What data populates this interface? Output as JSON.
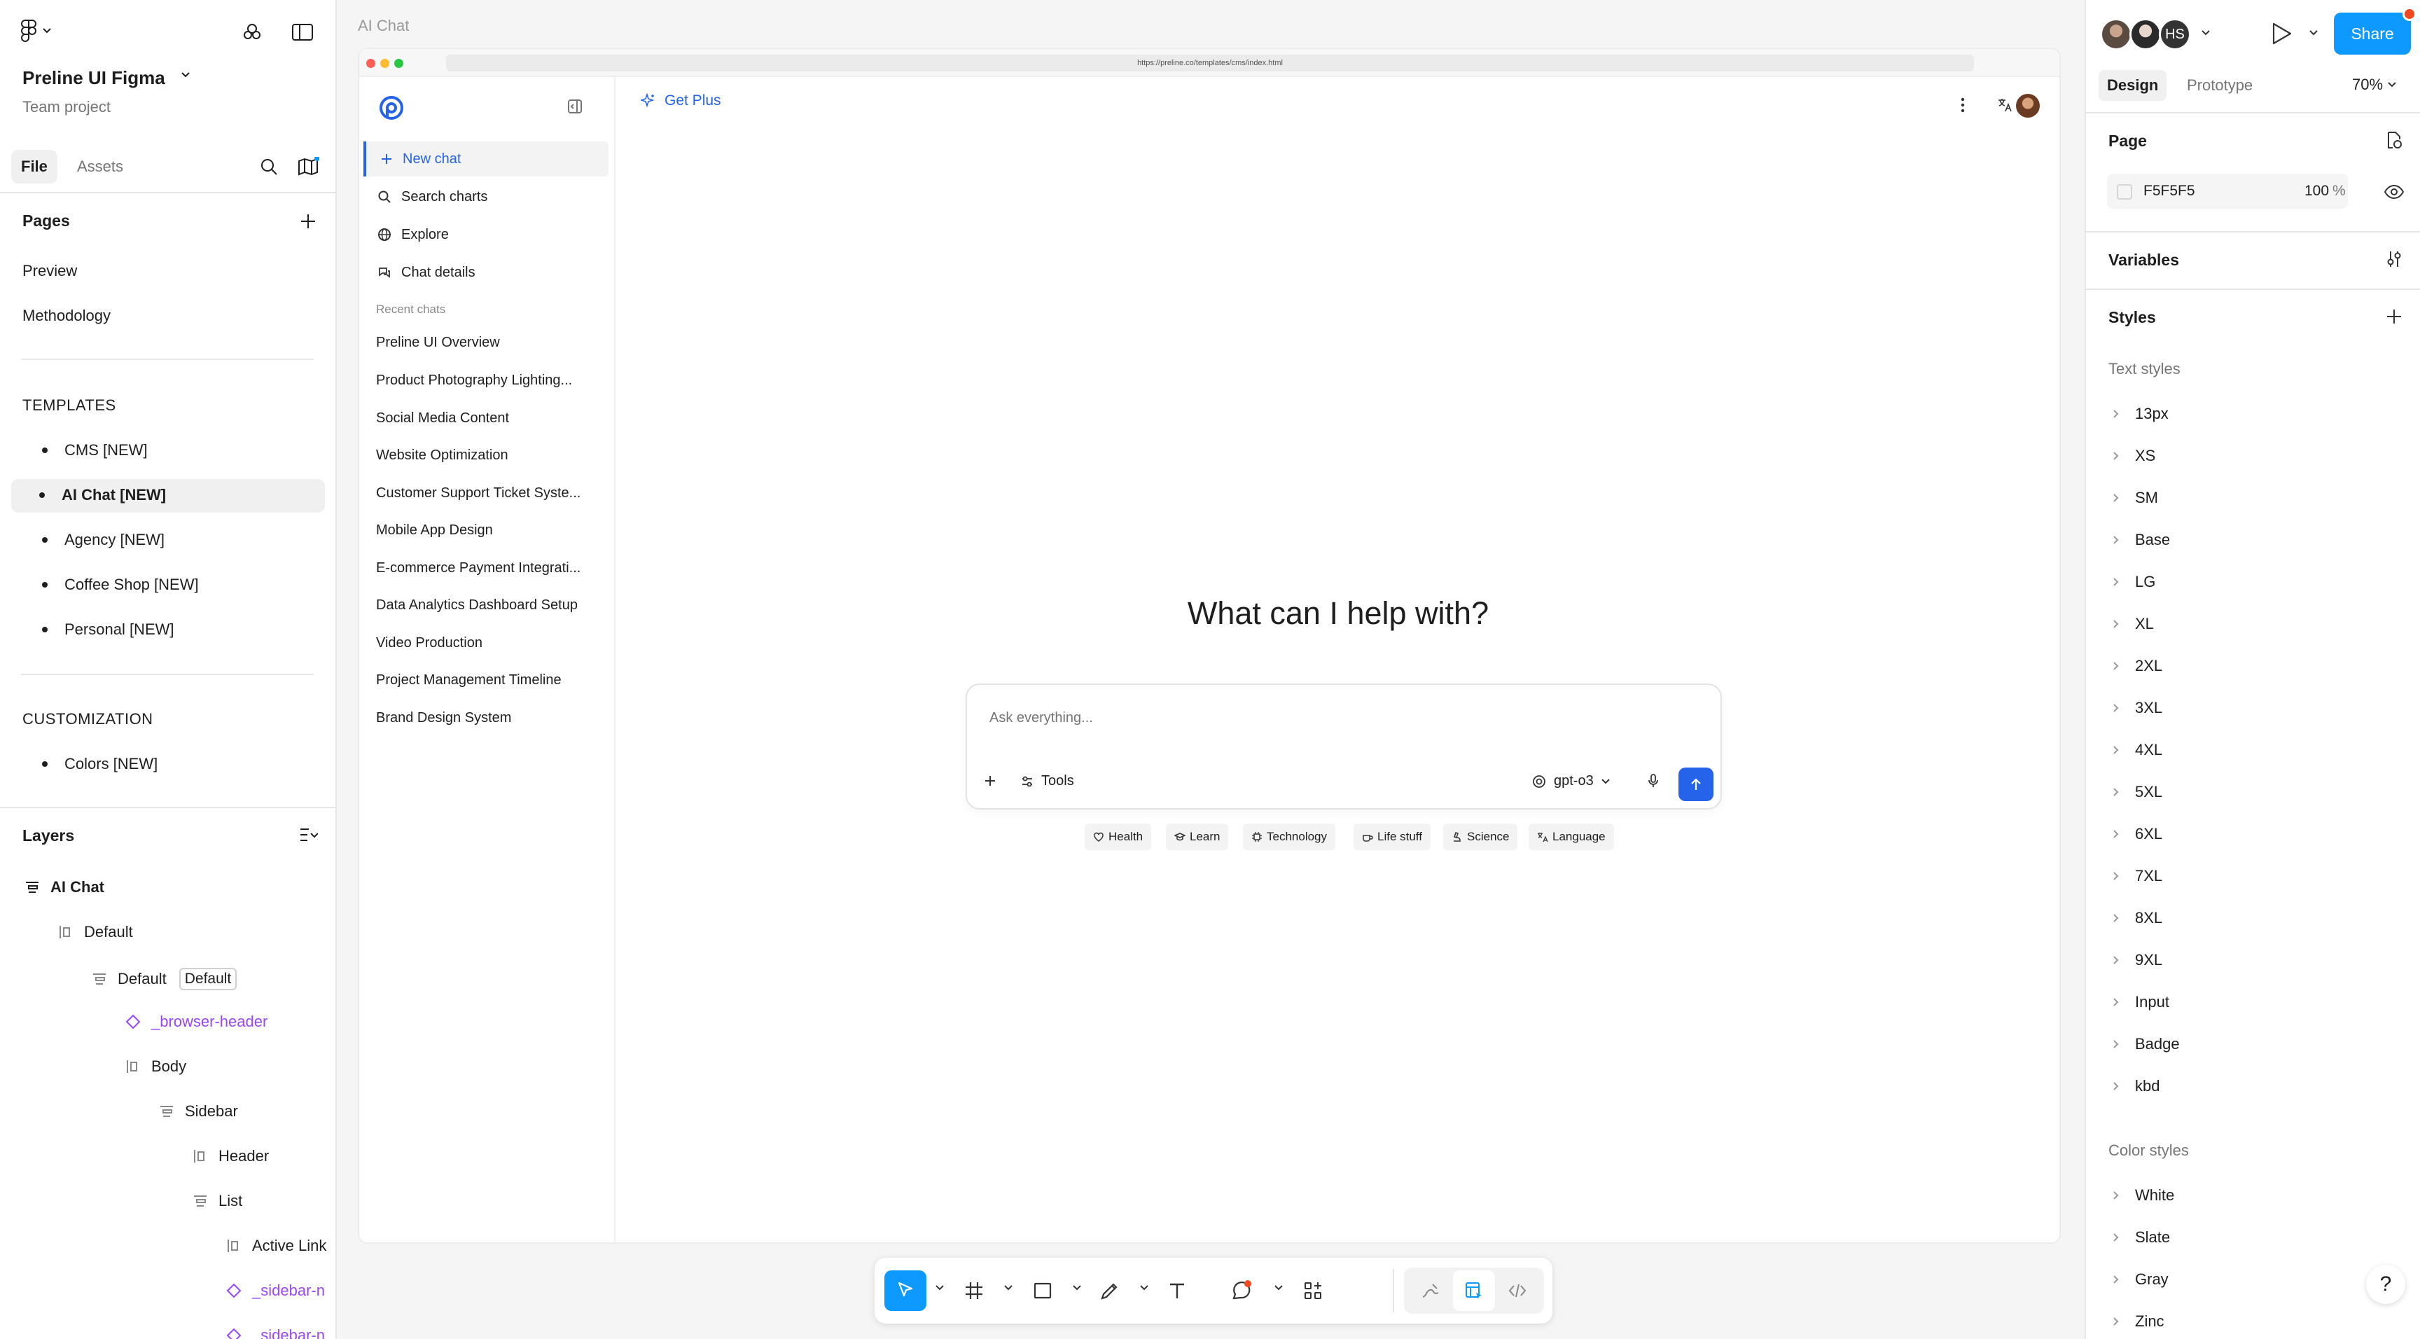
{
  "left_panel": {
    "project_name": "Preline UI Figma",
    "project_sub": "Team project",
    "tabs": {
      "file": "File",
      "assets": "Assets"
    },
    "pages_title": "Pages",
    "pages": [
      "Preview",
      "Methodology"
    ],
    "templates_heading": "TEMPLATES",
    "templates": [
      "CMS [NEW]",
      "AI Chat [NEW]",
      "Agency [NEW]",
      "Coffee Shop [NEW]",
      "Personal [NEW]"
    ],
    "customization_heading": "CUSTOMIZATION",
    "customization": [
      "Colors [NEW]"
    ],
    "layers_title": "Layers",
    "layers": {
      "root": "AI Chat",
      "default1": "Default",
      "default2": "Default",
      "default2_badge": "Default",
      "browser_header": "_browser-header",
      "body": "Body",
      "sidebar": "Sidebar",
      "header": "Header",
      "list": "List",
      "active_link": "Active Link",
      "sidebar_n1": "_sidebar-n",
      "sidebar_n2": "_sidebar-n"
    }
  },
  "canvas": {
    "frame_label": "AI Chat",
    "url": "https://preline.co/templates/cms/index.html",
    "sidebar": {
      "nav": [
        {
          "label": "New chat",
          "icon": "plus-icon"
        },
        {
          "label": "Search charts",
          "icon": "search-icon"
        },
        {
          "label": "Explore",
          "icon": "globe-icon"
        },
        {
          "label": "Chat details",
          "icon": "chat-icon"
        }
      ],
      "recent_title": "Recent chats",
      "recent": [
        "Preline UI Overview",
        "Product Photography Lighting...",
        "Social Media Content",
        "Website Optimization",
        "Customer Support Ticket Syste...",
        "Mobile App Design",
        "E-commerce Payment Integrati...",
        "Data Analytics Dashboard Setup",
        "Video Production",
        "Project Management Timeline",
        "Brand Design System"
      ]
    },
    "main": {
      "get_plus": "Get Plus",
      "hero": "What can I help with?",
      "input_placeholder": "Ask everything...",
      "tools_label": "Tools",
      "model_label": "gpt-o3",
      "chips": [
        "Health",
        "Learn",
        "Technology",
        "Life stuff",
        "Science",
        "Language"
      ]
    }
  },
  "right_panel": {
    "avatar_initials": "HS",
    "share_label": "Share",
    "tabs": {
      "design": "Design",
      "prototype": "Prototype"
    },
    "zoom": "70%",
    "page_title": "Page",
    "page_color": "F5F5F5",
    "page_opacity": "100",
    "page_opacity_unit": "%",
    "variables_title": "Variables",
    "styles_title": "Styles",
    "text_styles_title": "Text styles",
    "text_styles": [
      "13px",
      "XS",
      "SM",
      "Base",
      "LG",
      "XL",
      "2XL",
      "3XL",
      "4XL",
      "5XL",
      "6XL",
      "7XL",
      "8XL",
      "9XL",
      "Input",
      "Badge",
      "kbd"
    ],
    "color_styles_title": "Color styles",
    "color_styles": [
      "White",
      "Slate",
      "Gray",
      "Zinc"
    ],
    "help_label": "?"
  },
  "colors": {
    "accent_blue": "#0d99ff",
    "preline_blue": "#2563eb",
    "component_purple": "#9747ff"
  }
}
